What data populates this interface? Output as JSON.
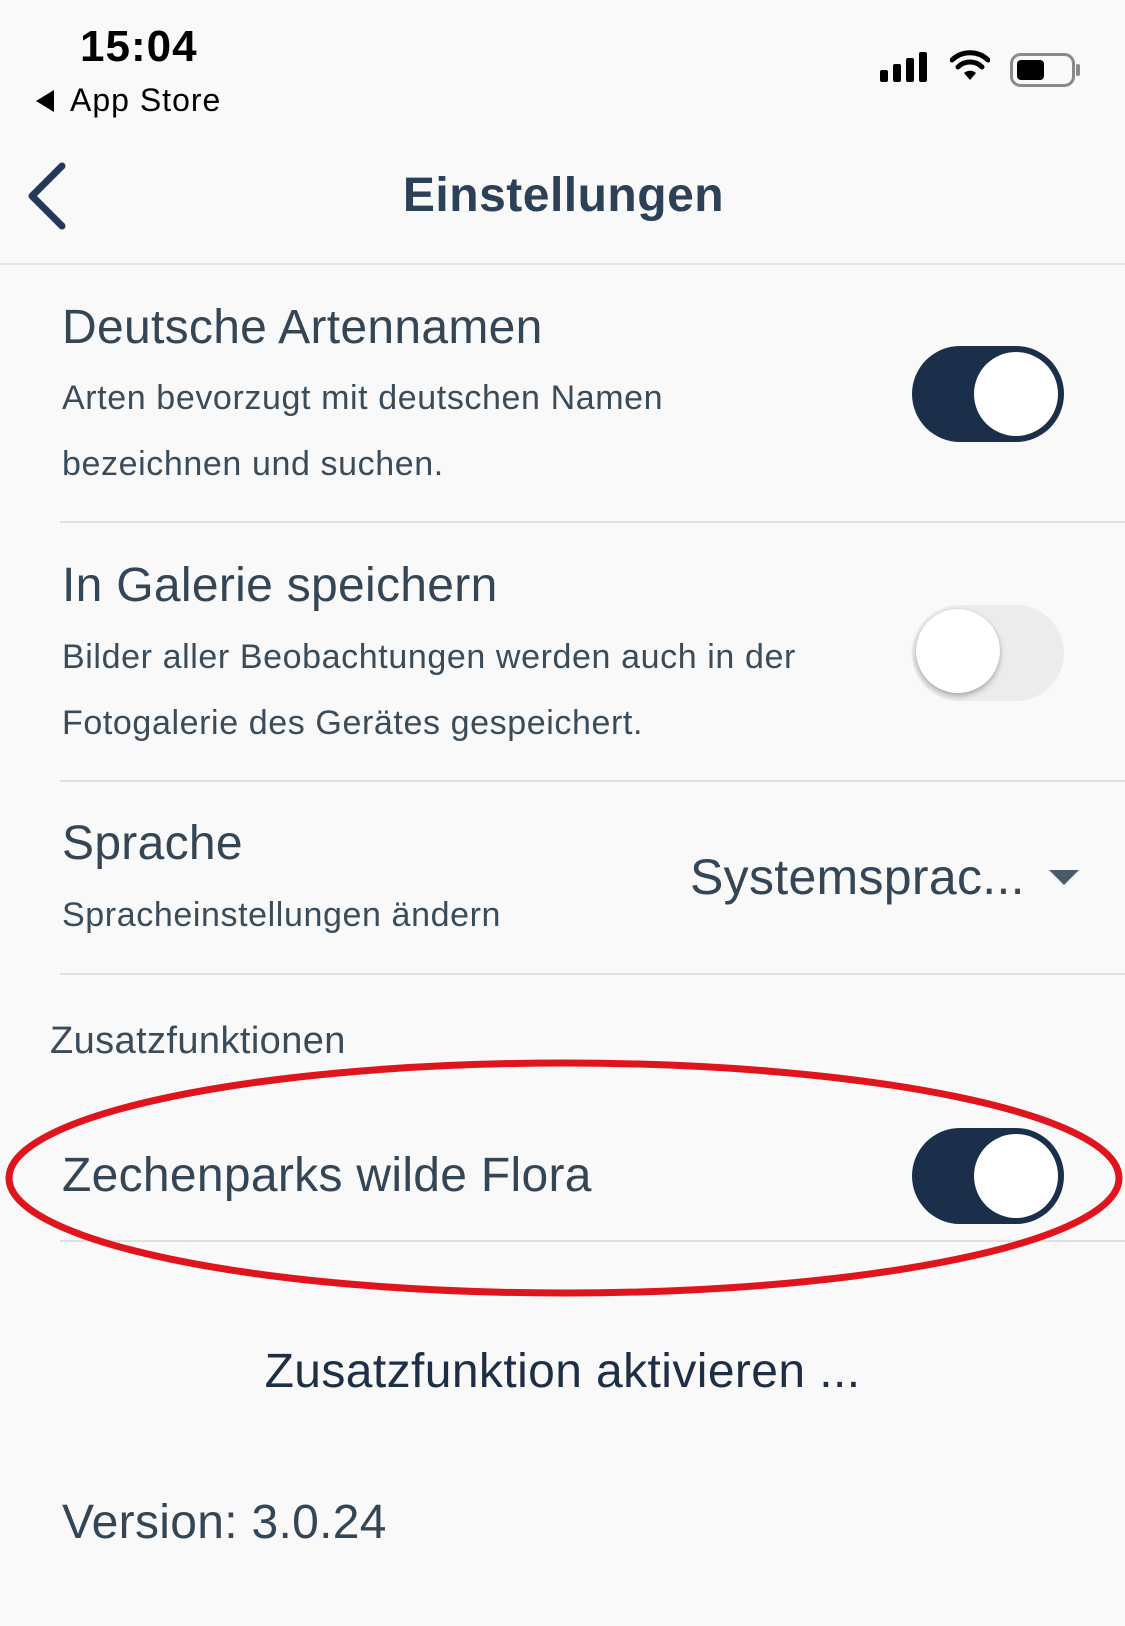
{
  "status_bar": {
    "time": "15:04",
    "back_app": "App Store",
    "icons": [
      "signal-icon",
      "wifi-icon",
      "battery-icon"
    ]
  },
  "header": {
    "title": "Einstellungen",
    "back_icon": "chevron-left-icon"
  },
  "settings": {
    "german_names": {
      "title": "Deutsche Artennamen",
      "description": "Arten bevorzugt mit deutschen Namen bezeichnen und suchen.",
      "toggle_on": true
    },
    "gallery": {
      "title": "In Galerie speichern",
      "description": "Bilder aller Beobachtungen werden auch in der Fotogalerie des Gerätes gespeichert.",
      "toggle_on": false
    },
    "language": {
      "title": "Sprache",
      "description": "Spracheinstellungen ändern",
      "selected": "Systemsprac..."
    }
  },
  "extras": {
    "section_label": "Zusatzfunktionen",
    "item": {
      "title": "Zechenparks wilde Flora",
      "toggle_on": true
    },
    "activate_label": "Zusatzfunktion aktivieren ..."
  },
  "version": "Version: 3.0.24",
  "colors": {
    "toggle_on": "#1b2f4b",
    "toggle_off": "#ececec",
    "text": "#344656",
    "highlight": "#e0141c",
    "background": "#f9f9f9"
  }
}
